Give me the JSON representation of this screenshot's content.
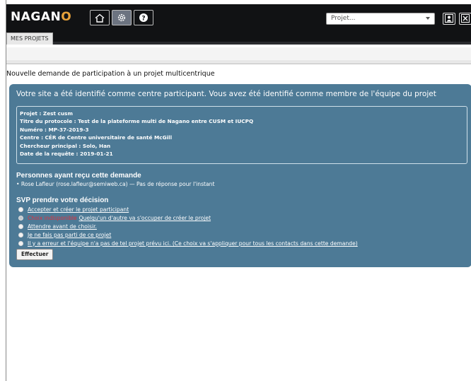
{
  "app": {
    "logo_prefix": "NAGAN",
    "logo_suffix": "O",
    "accent_color": "#e8a23a"
  },
  "header": {
    "nav_icons": [
      "home-icon",
      "gear-icon",
      "help-icon"
    ],
    "active_nav": "gear-icon",
    "project_select": {
      "placeholder": "Projet..."
    },
    "right_icons": [
      "user-icon",
      "close-icon"
    ]
  },
  "tabs": [
    {
      "label": "MES PROJETS"
    }
  ],
  "page": {
    "title": "Nouvelle demande de participation à un projet multicentrique"
  },
  "panel": {
    "heading": "Votre site a été identifié comme centre participant. Vous avez été identifié comme membre de l'équipe du projet",
    "color": "#4d7a96",
    "info": [
      "Projet : Zest cusm",
      "Titre du protocole : Test de la plateforme multi de Nagano entre CUSM et IUCPQ",
      "Numéro : MP-37-2019-3",
      "Centre : CÉR de Centre universitaire de santé McGill",
      "Chercheur principal : Solo, Han",
      "Date de la requête : 2019-01-21"
    ],
    "recipients_title": "Personnes ayant reçu cette demande",
    "recipient": "• Rose Lafleur (rose.lafleur@semiweb.ca) — Pas de réponse pour l'instant",
    "decision_title": "SVP prendre votre décision",
    "options": [
      {
        "label": "Accepter et créer le projet participant"
      },
      {
        "unavailable": "Choix indisponible",
        "label": "Quelqu'un d'autre va s'occuper de créer le projet"
      },
      {
        "label": "Attendre avant de choisir."
      },
      {
        "label": "Je ne fais pas parti de ce projet"
      },
      {
        "label": "Il y a erreur et l'équipe n'a pas de tel projet prévu ici. (Ce choix va s'appliquer pour tous les contacts dans cette demande)"
      }
    ],
    "submit_label": "Effectuer"
  }
}
